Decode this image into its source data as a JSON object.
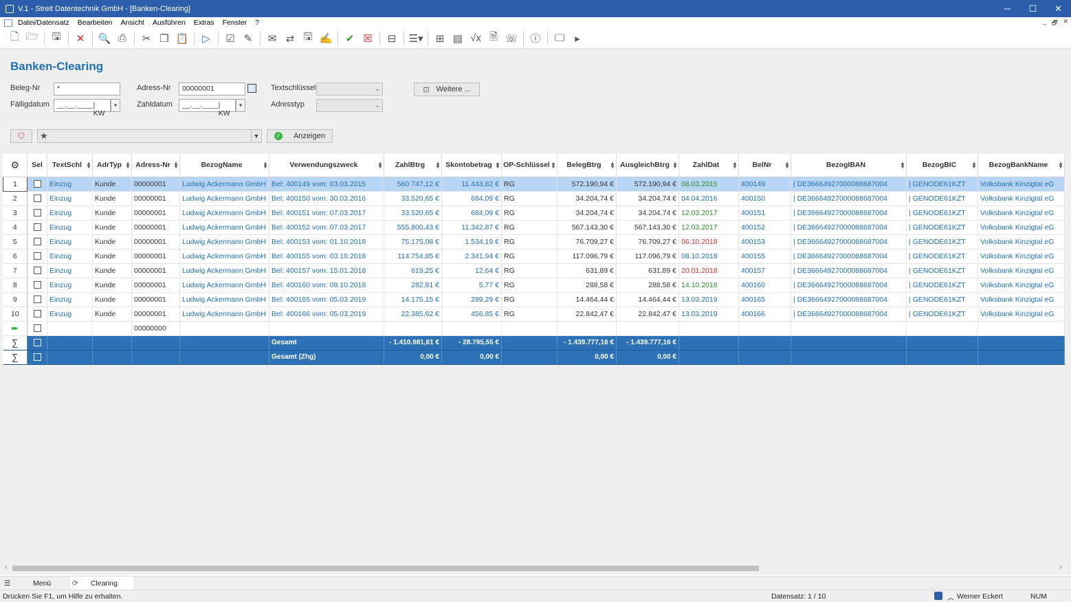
{
  "window": {
    "title": "V.1 - Streit Datentechnik GmbH - [Banken-Clearing]",
    "minimize": "─",
    "maximize": "☐",
    "close": "✕"
  },
  "menu": [
    "Datei/Datensatz",
    "Bearbeiten",
    "Ansicht",
    "Ausführen",
    "Extras",
    "Fenster",
    "?"
  ],
  "mdi_controls": [
    "_",
    "🗗",
    "✕"
  ],
  "toolbar_icons": [
    "new-doc-icon",
    "open-folder-icon",
    "save-icon",
    "delete-icon",
    "preview-icon",
    "print-icon",
    "cut-icon",
    "copy-icon",
    "paste-icon",
    "run-icon",
    "check-icon",
    "edit-icon",
    "mail-icon",
    "transfer-icon",
    "disk-icon",
    "sign-icon",
    "approve-icon",
    "reject-icon",
    "archive-icon",
    "layout-icon",
    "table-icon",
    "form-icon",
    "formula-icon",
    "note-icon",
    "phone-icon",
    "help-icon",
    "monitor-icon",
    "play-icon"
  ],
  "page": {
    "title": "Banken-Clearing"
  },
  "filters": {
    "beleg_nr_label": "Beleg-Nr",
    "beleg_nr_value": "*",
    "adress_nr_label": "Adress-Nr",
    "adress_nr_value": "00000001",
    "textschluessel_label": "Textschlüssel",
    "faelligdatum_label": "Fälligdatum",
    "faelligdatum_value": "__.__.____",
    "kw_label": "| KW",
    "zahldatum_label": "Zahldatum",
    "zahldatum_value": "__.__.____",
    "adresstyp_label": "Adresstyp",
    "weitere_label": "Weitere ...",
    "anzeigen_label": "Anzeigen"
  },
  "table": {
    "columns": [
      "Sel",
      "TextSchl",
      "AdrTyp",
      "Adress-Nr",
      "BezogName",
      "Verwendungszweck",
      "ZahlBtrg",
      "Skontobetrag",
      "OP-Schlüssel",
      "BelegBtrg",
      "AusgleichBtrg",
      "ZahlDat",
      "BelNr",
      "BezogIBAN",
      "BezogBIC",
      "BezogBankName"
    ],
    "rows": [
      {
        "n": "1",
        "textschl": "Einzug",
        "adrtyp": "Kunde",
        "adrnr": "00000001",
        "name": "Ludwig Ackermann GmbH",
        "zweck": "Bel: 400149 vom: 03.03.2015",
        "zahl": "560.747,12 €",
        "skonto": "11.443,82 €",
        "op": "RG",
        "beleg": "572.190,94 €",
        "ausgl": "572.190,94 €",
        "datum": "08.03.2015",
        "datcol": "grn",
        "belnr": "400149",
        "iban": "| DE36664927000088687004",
        "bic": "| GENODE61KZT",
        "bank": "Volksbank Kinzigtal eG"
      },
      {
        "n": "2",
        "textschl": "Einzug",
        "adrtyp": "Kunde",
        "adrnr": "00000001",
        "name": "Ludwig Ackermann GmbH",
        "zweck": "Bel: 400150 vom: 30.03.2016",
        "zahl": "33.520,65 €",
        "skonto": "684,09 €",
        "op": "RG",
        "beleg": "34.204,74 €",
        "ausgl": "34.204,74 €",
        "datum": "04.04.2016",
        "datcol": "link",
        "belnr": "400150",
        "iban": "| DE36664927000088687004",
        "bic": "| GENODE61KZT",
        "bank": "Volksbank Kinzigtal eG"
      },
      {
        "n": "3",
        "textschl": "Einzug",
        "adrtyp": "Kunde",
        "adrnr": "00000001",
        "name": "Ludwig Ackermann GmbH",
        "zweck": "Bel: 400151 vom: 07.03.2017",
        "zahl": "33.520,65 €",
        "skonto": "684,09 €",
        "op": "RG",
        "beleg": "34.204,74 €",
        "ausgl": "34.204,74 €",
        "datum": "12.03.2017",
        "datcol": "grn",
        "belnr": "400151",
        "iban": "| DE36664927000088687004",
        "bic": "| GENODE61KZT",
        "bank": "Volksbank Kinzigtal eG"
      },
      {
        "n": "4",
        "textschl": "Einzug",
        "adrtyp": "Kunde",
        "adrnr": "00000001",
        "name": "Ludwig Ackermann GmbH",
        "zweck": "Bel: 400152 vom: 07.03.2017",
        "zahl": "555.800,43 €",
        "skonto": "11.342,87 €",
        "op": "RG",
        "beleg": "567.143,30 €",
        "ausgl": "567.143,30 €",
        "datum": "12.03.2017",
        "datcol": "grn",
        "belnr": "400152",
        "iban": "| DE36664927000088687004",
        "bic": "| GENODE61KZT",
        "bank": "Volksbank Kinzigtal eG"
      },
      {
        "n": "5",
        "textschl": "Einzug",
        "adrtyp": "Kunde",
        "adrnr": "00000001",
        "name": "Ludwig Ackermann GmbH",
        "zweck": "Bel: 400153 vom: 01.10.2018",
        "zahl": "75.175,08 €",
        "skonto": "1.534,19 €",
        "op": "RG",
        "beleg": "76.709,27 €",
        "ausgl": "76.709,27 €",
        "datum": "06.10.2018",
        "datcol": "red",
        "belnr": "400153",
        "iban": "| DE36664927000088687004",
        "bic": "| GENODE61KZT",
        "bank": "Volksbank Kinzigtal eG"
      },
      {
        "n": "6",
        "textschl": "Einzug",
        "adrtyp": "Kunde",
        "adrnr": "00000001",
        "name": "Ludwig Ackermann GmbH",
        "zweck": "Bel: 400155 vom: 03.10.2018",
        "zahl": "114.754,85 €",
        "skonto": "2.341,94 €",
        "op": "RG",
        "beleg": "117.096,79 €",
        "ausgl": "117.096,79 €",
        "datum": "08.10.2018",
        "datcol": "link",
        "belnr": "400155",
        "iban": "| DE36664927000088687004",
        "bic": "| GENODE61KZT",
        "bank": "Volksbank Kinzigtal eG"
      },
      {
        "n": "7",
        "textschl": "Einzug",
        "adrtyp": "Kunde",
        "adrnr": "00000001",
        "name": "Ludwig Ackermann GmbH",
        "zweck": "Bel: 400157 vom: 15.01.2018",
        "zahl": "619,25 €",
        "skonto": "12,64 €",
        "op": "RG",
        "beleg": "631,89 €",
        "ausgl": "631,89 €",
        "datum": "20.01.2018",
        "datcol": "red",
        "belnr": "400157",
        "iban": "| DE36664927000088687004",
        "bic": "| GENODE61KZT",
        "bank": "Volksbank Kinzigtal eG"
      },
      {
        "n": "8",
        "textschl": "Einzug",
        "adrtyp": "Kunde",
        "adrnr": "00000001",
        "name": "Ludwig Ackermann GmbH",
        "zweck": "Bel: 400160 vom: 09.10.2018",
        "zahl": "282,81 €",
        "skonto": "5,77 €",
        "op": "RG",
        "beleg": "288,58 €",
        "ausgl": "288,58 €",
        "datum": "14.10.2018",
        "datcol": "grn",
        "belnr": "400160",
        "iban": "| DE36664927000088687004",
        "bic": "| GENODE61KZT",
        "bank": "Volksbank Kinzigtal eG"
      },
      {
        "n": "9",
        "textschl": "Einzug",
        "adrtyp": "Kunde",
        "adrnr": "00000001",
        "name": "Ludwig Ackermann GmbH",
        "zweck": "Bel: 400165 vom: 05.03.2019",
        "zahl": "14.175,15 €",
        "skonto": "289,29 €",
        "op": "RG",
        "beleg": "14.464,44 €",
        "ausgl": "14.464,44 €",
        "datum": "13.03.2019",
        "datcol": "link",
        "belnr": "400165",
        "iban": "| DE36664927000088687004",
        "bic": "| GENODE61KZT",
        "bank": "Volksbank Kinzigtal eG"
      },
      {
        "n": "10",
        "textschl": "Einzug",
        "adrtyp": "Kunde",
        "adrnr": "00000001",
        "name": "Ludwig Ackermann GmbH",
        "zweck": "Bel: 400166 vom: 05.03.2019",
        "zahl": "22.385,62 €",
        "skonto": "456,85 €",
        "op": "RG",
        "beleg": "22.842,47 €",
        "ausgl": "22.842,47 €",
        "datum": "13.03.2019",
        "datcol": "link",
        "belnr": "400166",
        "iban": "| DE36664927000088687004",
        "bic": "| GENODE61KZT",
        "bank": "Volksbank Kinzigtal eG"
      }
    ],
    "new_row": {
      "adrnr": "00000000"
    },
    "sums": [
      {
        "label": "Gesamt",
        "zahl": "- 1.410.981,61 €",
        "skonto": "- 28.795,55 €",
        "beleg": "- 1.439.777,16 €",
        "ausgl": "- 1.439.777,16 €"
      },
      {
        "label": "Gesamt (Zhg)",
        "zahl": "0,00 €",
        "skonto": "0,00 €",
        "beleg": "0,00 €",
        "ausgl": "0,00 €"
      }
    ]
  },
  "tabs": {
    "menu_label": "Menü",
    "clearing_label": "Clearing"
  },
  "status": {
    "help": "Drücken Sie F1, um Hilfe zu erhalten.",
    "records": "Datensatz: 1 / 10",
    "user": "Werner Eckert",
    "num": "NUM"
  }
}
